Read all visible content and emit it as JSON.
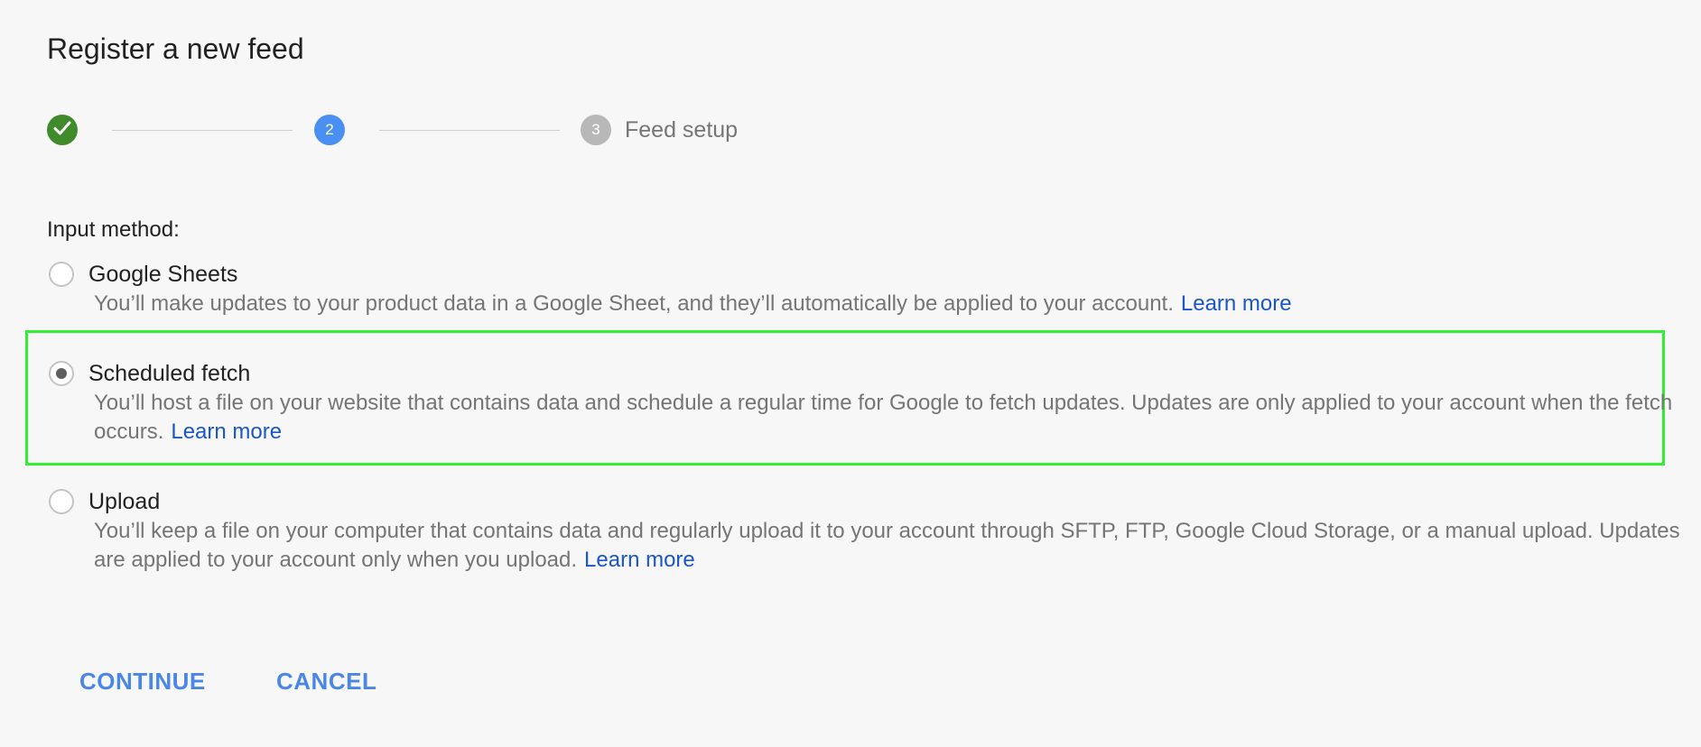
{
  "title": "Register a new feed",
  "stepper": {
    "steps": [
      {
        "number": "",
        "status": "complete",
        "icon": "checkmark-icon"
      },
      {
        "number": "2",
        "status": "active"
      },
      {
        "number": "3",
        "status": "pending",
        "label": "Feed setup"
      }
    ]
  },
  "input_method": {
    "label": "Input method:",
    "selected": "Scheduled fetch",
    "options": [
      {
        "title": "Google Sheets",
        "description": "You’ll make updates to your product data in a Google Sheet, and they’ll automatically be applied to your account.",
        "link": "Learn more",
        "selected": false
      },
      {
        "title": "Scheduled fetch",
        "description": "You’ll host a file on your website that contains data and schedule a regular time for Google to fetch updates. Updates are only applied to your account when the fetch occurs.",
        "link": "Learn more",
        "selected": true
      },
      {
        "title": "Upload",
        "description": "You’ll keep a file on your computer that contains data and regularly upload it to your account through SFTP, FTP, Google Cloud Storage, or a manual upload. Updates are applied to your account only when you upload.",
        "link": "Learn more",
        "selected": false
      }
    ]
  },
  "actions": {
    "continue_label": "CONTINUE",
    "cancel_label": "CANCEL"
  },
  "colors": {
    "background": "#f7f7f7",
    "step_complete": "#3f8b2b",
    "step_active": "#4a90f2",
    "step_pending": "#b8b8b8",
    "link": "#1a56c7",
    "button": "#4a86e8",
    "highlight": "#33ee33"
  }
}
